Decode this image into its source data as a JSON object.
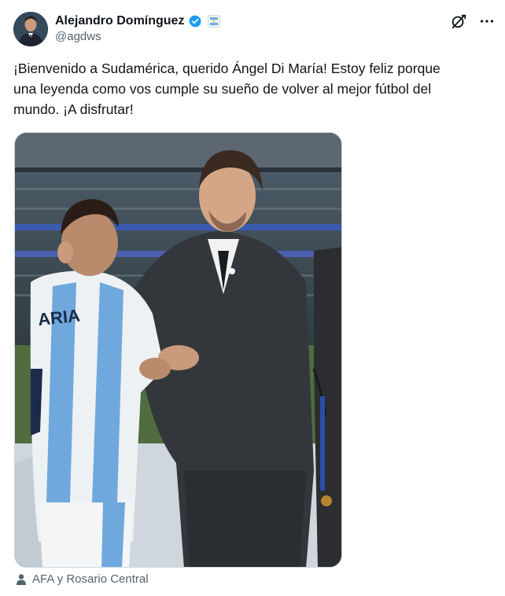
{
  "author": {
    "display_name": "Alejandro Domínguez",
    "handle": "@agdws",
    "verified": true,
    "affiliate_badge_icon": "affiliate-badge-icon"
  },
  "header_actions": {
    "grok_icon": "grok-icon",
    "more_icon": "more-icon"
  },
  "tweet": {
    "text": "¡Bienvenido a Sudamérica, querido Ángel Di María! Estoy feliz porque\nuna leyenda como vos cumple su sueño de volver al mejor fútbol del\nmundo. ¡A disfrutar!"
  },
  "media": {
    "jersey_text": "ARIA"
  },
  "tags": {
    "icon": "person-icon",
    "text": "AFA y Rosario Central"
  },
  "colors": {
    "text_primary": "#0f1419",
    "text_secondary": "#536471",
    "verified_blue": "#1d9bf0",
    "border": "#cfd9de"
  }
}
